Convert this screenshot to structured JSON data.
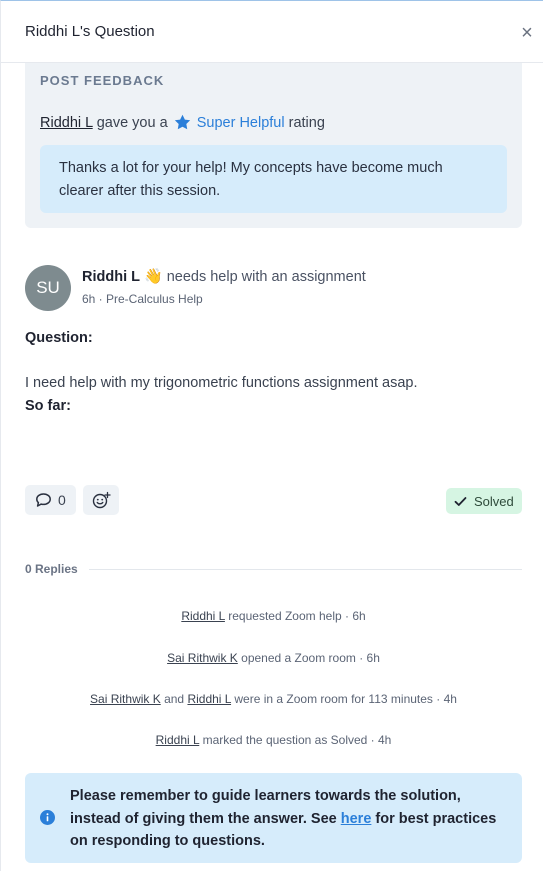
{
  "header": {
    "title": "Riddhi L's Question",
    "close_symbol": "×"
  },
  "feedback": {
    "heading": "POST FEEDBACK",
    "user": "Riddhi L",
    "text_before": "gave you a",
    "rating": "Super Helpful",
    "text_after": "rating",
    "rating_color": "#2b7fd9",
    "quote": "Thanks a lot for your help! My concepts have become much clearer after this session."
  },
  "post": {
    "avatar_initials": "SU",
    "author": "Riddhi L",
    "wave_emoji": "👋",
    "action": "needs help with an assignment",
    "meta": "6h · Pre-Calculus Help",
    "question_label": "Question:",
    "question_body": "I need help with my trigonometric functions assignment asap.",
    "so_far_label": "So far:"
  },
  "toolbar": {
    "comment_icon": "comment-icon",
    "comment_count": "0",
    "react_icon": "emoji-add-icon",
    "solved_label": "Solved"
  },
  "replies": {
    "label": "0 Replies"
  },
  "activity": [
    {
      "user1": "Riddhi L",
      "text": "requested Zoom help · 6h"
    },
    {
      "user1": "Sai Rithwik K",
      "text": "opened a Zoom room · 6h"
    },
    {
      "user1": "Sai Rithwik K",
      "joiner": "and",
      "user2": "Riddhi L",
      "text": "were in a Zoom room for 113 minutes · 4h"
    },
    {
      "user1": "Riddhi L",
      "text": "marked the question as Solved · 4h"
    }
  ],
  "notice": {
    "text_before": "Please remember to guide learners towards the solution, instead of giving them the answer. See",
    "link": "here",
    "text_after": "for best practices on responding to questions."
  }
}
